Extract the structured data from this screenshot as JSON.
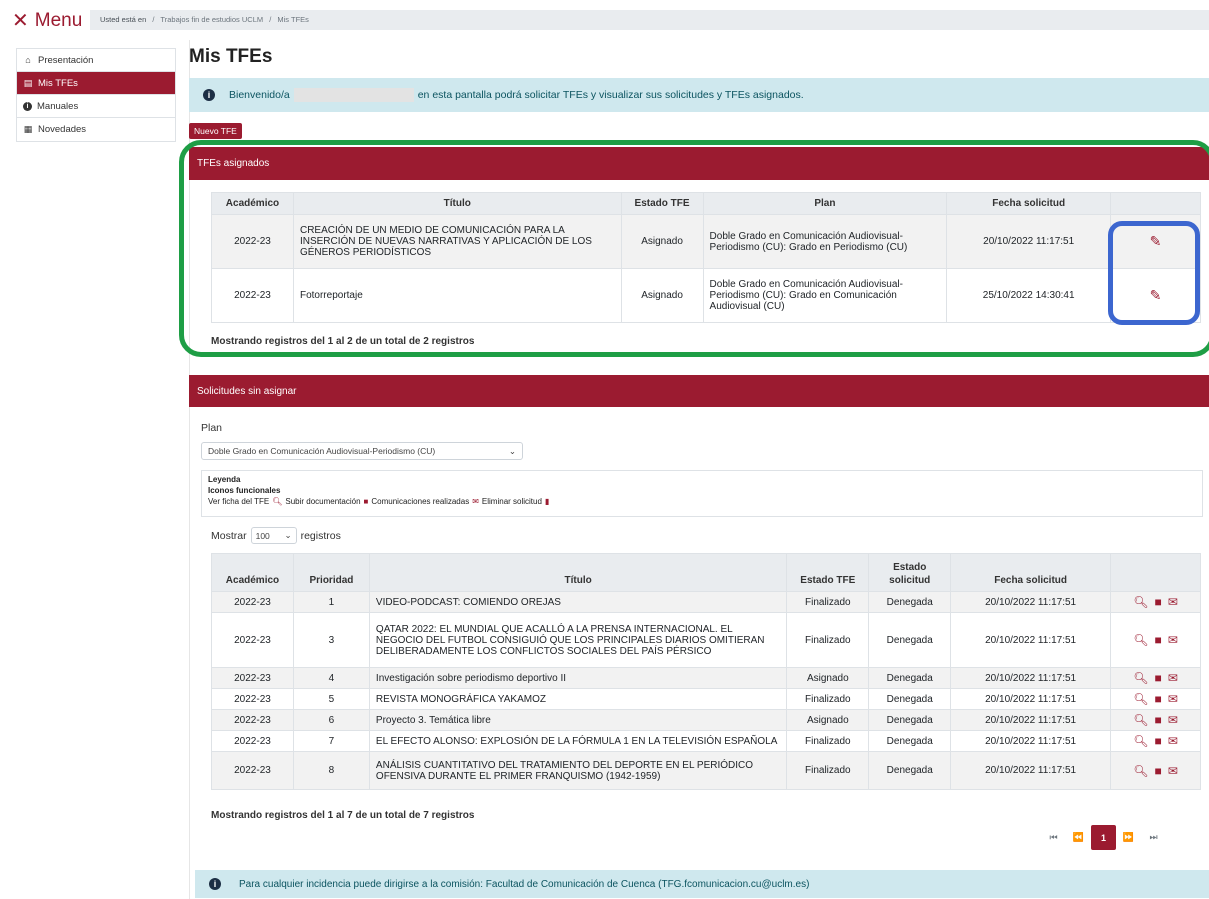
{
  "topbar": {
    "menu_label": "Menu",
    "close_glyph": "✕"
  },
  "breadcrumb": {
    "prefix": "Usted está en",
    "sep": "/",
    "items": [
      "Trabajos fin de estudios UCLM",
      "Mis TFEs"
    ]
  },
  "sidebar": {
    "items": [
      {
        "label": "Presentación",
        "icon": "home-icon",
        "glyph": "⌂"
      },
      {
        "label": "Mis TFEs",
        "icon": "document-icon",
        "glyph": "▤"
      },
      {
        "label": "Manuales",
        "icon": "info-icon",
        "glyph": "i"
      },
      {
        "label": "Novedades",
        "icon": "newspaper-icon",
        "glyph": "▦"
      }
    ]
  },
  "page": {
    "title": "Mis TFEs"
  },
  "welcome": {
    "prefix": "Bienvenido/a",
    "suffix": "en esta pantalla podrá solicitar TFEs y visualizar sus solicitudes y TFEs asignados."
  },
  "new_button": {
    "label": "Nuevo TFE"
  },
  "assigned": {
    "header": "TFEs asignados",
    "columns": [
      "Académico",
      "Título",
      "Estado TFE",
      "Plan",
      "Fecha solicitud",
      ""
    ],
    "rows": [
      {
        "academic": "2022-23",
        "title": "CREACIÓN DE UN MEDIO DE COMUNICACIÓN PARA LA INSERCIÓN DE NUEVAS NARRATIVAS Y APLICACIÓN DE LOS GÉNEROS PERIODÍSTICOS",
        "status": "Asignado",
        "plan": "Doble Grado en Comunicación Audiovisual-Periodismo (CU): Grado en Periodismo (CU)",
        "date": "20/10/2022 11:17:51"
      },
      {
        "academic": "2022-23",
        "title": "Fotorreportaje",
        "status": "Asignado",
        "plan": "Doble Grado en Comunicación Audiovisual-Periodismo (CU): Grado en Comunicación Audiovisual (CU)",
        "date": "25/10/2022 14:30:41"
      }
    ],
    "summary": "Mostrando registros del 1 al 2 de un total de 2 registros",
    "edit_glyph": "✎"
  },
  "unassigned": {
    "header": "Solicitudes sin asignar",
    "plan_label": "Plan",
    "plan_selected": "Doble Grado en Comunicación Audiovisual-Periodismo (CU)",
    "legend": {
      "title": "Leyenda",
      "subtitle": "Iconos funcionales",
      "items": [
        "Ver ficha del TFE",
        "Subir documentación",
        "Comunicaciones realizadas",
        "Eliminar solicitud"
      ]
    },
    "show_prefix": "Mostrar",
    "show_value": "100",
    "show_suffix": "registros",
    "columns": [
      "Académico",
      "Prioridad",
      "Título",
      "Estado TFE",
      "Estado solicitud",
      "Fecha solicitud",
      ""
    ],
    "rows": [
      {
        "academic": "2022-23",
        "priority": "1",
        "title": "VIDEO-PODCAST: COMIENDO OREJAS",
        "tfe_status": "Finalizado",
        "req_status": "Denegada",
        "date": "20/10/2022 11:17:51"
      },
      {
        "academic": "2022-23",
        "priority": "3",
        "title": "QATAR 2022: EL MUNDIAL QUE ACALLÓ A LA PRENSA INTERNACIONAL. EL NEGOCIO DEL FUTBOL CONSIGUIÓ QUE LOS PRINCIPALES DIARIOS OMITIERAN DELIBERADAMENTE LOS CONFLICTOS SOCIALES DEL PAÍS PÉRSICO",
        "tfe_status": "Finalizado",
        "req_status": "Denegada",
        "date": "20/10/2022 11:17:51"
      },
      {
        "academic": "2022-23",
        "priority": "4",
        "title": "Investigación sobre periodismo deportivo II",
        "tfe_status": "Asignado",
        "req_status": "Denegada",
        "date": "20/10/2022 11:17:51"
      },
      {
        "academic": "2022-23",
        "priority": "5",
        "title": "REVISTA MONOGRÁFICA YAKAMOZ",
        "tfe_status": "Finalizado",
        "req_status": "Denegada",
        "date": "20/10/2022 11:17:51"
      },
      {
        "academic": "2022-23",
        "priority": "6",
        "title": "Proyecto 3. Temática libre",
        "tfe_status": "Asignado",
        "req_status": "Denegada",
        "date": "20/10/2022 11:17:51"
      },
      {
        "academic": "2022-23",
        "priority": "7",
        "title": "EL EFECTO ALONSO: EXPLOSIÓN DE LA FÓRMULA 1 EN LA TELEVISIÓN ESPAÑOLA",
        "tfe_status": "Finalizado",
        "req_status": "Denegada",
        "date": "20/10/2022 11:17:51"
      },
      {
        "academic": "2022-23",
        "priority": "8",
        "title": "ANÁLISIS CUANTITATIVO DEL TRATAMIENTO DEL DEPORTE EN EL PERIÓDICO OFENSIVA DURANTE EL PRIMER FRANQUISMO (1942-1959)",
        "tfe_status": "Finalizado",
        "req_status": "Denegada",
        "date": "20/10/2022 11:17:51"
      }
    ],
    "summary": "Mostrando registros del 1 al 7 de un total de 7 registros",
    "action_icons": [
      "search-icon",
      "file-icon",
      "envelope-check-icon"
    ]
  },
  "pager": {
    "first": "⏮",
    "prev": "⏪",
    "current": "1",
    "next": "⏩",
    "last": "⏭"
  },
  "footer_alert": {
    "text": "Para cualquier incidencia puede dirigirse a la comisión: Facultad de Comunicación de Cuenca (TFG.fcomunicacion.cu@uclm.es)"
  },
  "colors": {
    "brand": "#9b1b30",
    "info_bg": "#cfe8ee",
    "highlight_green": "#1e9e45",
    "highlight_blue": "#3c66cf"
  }
}
